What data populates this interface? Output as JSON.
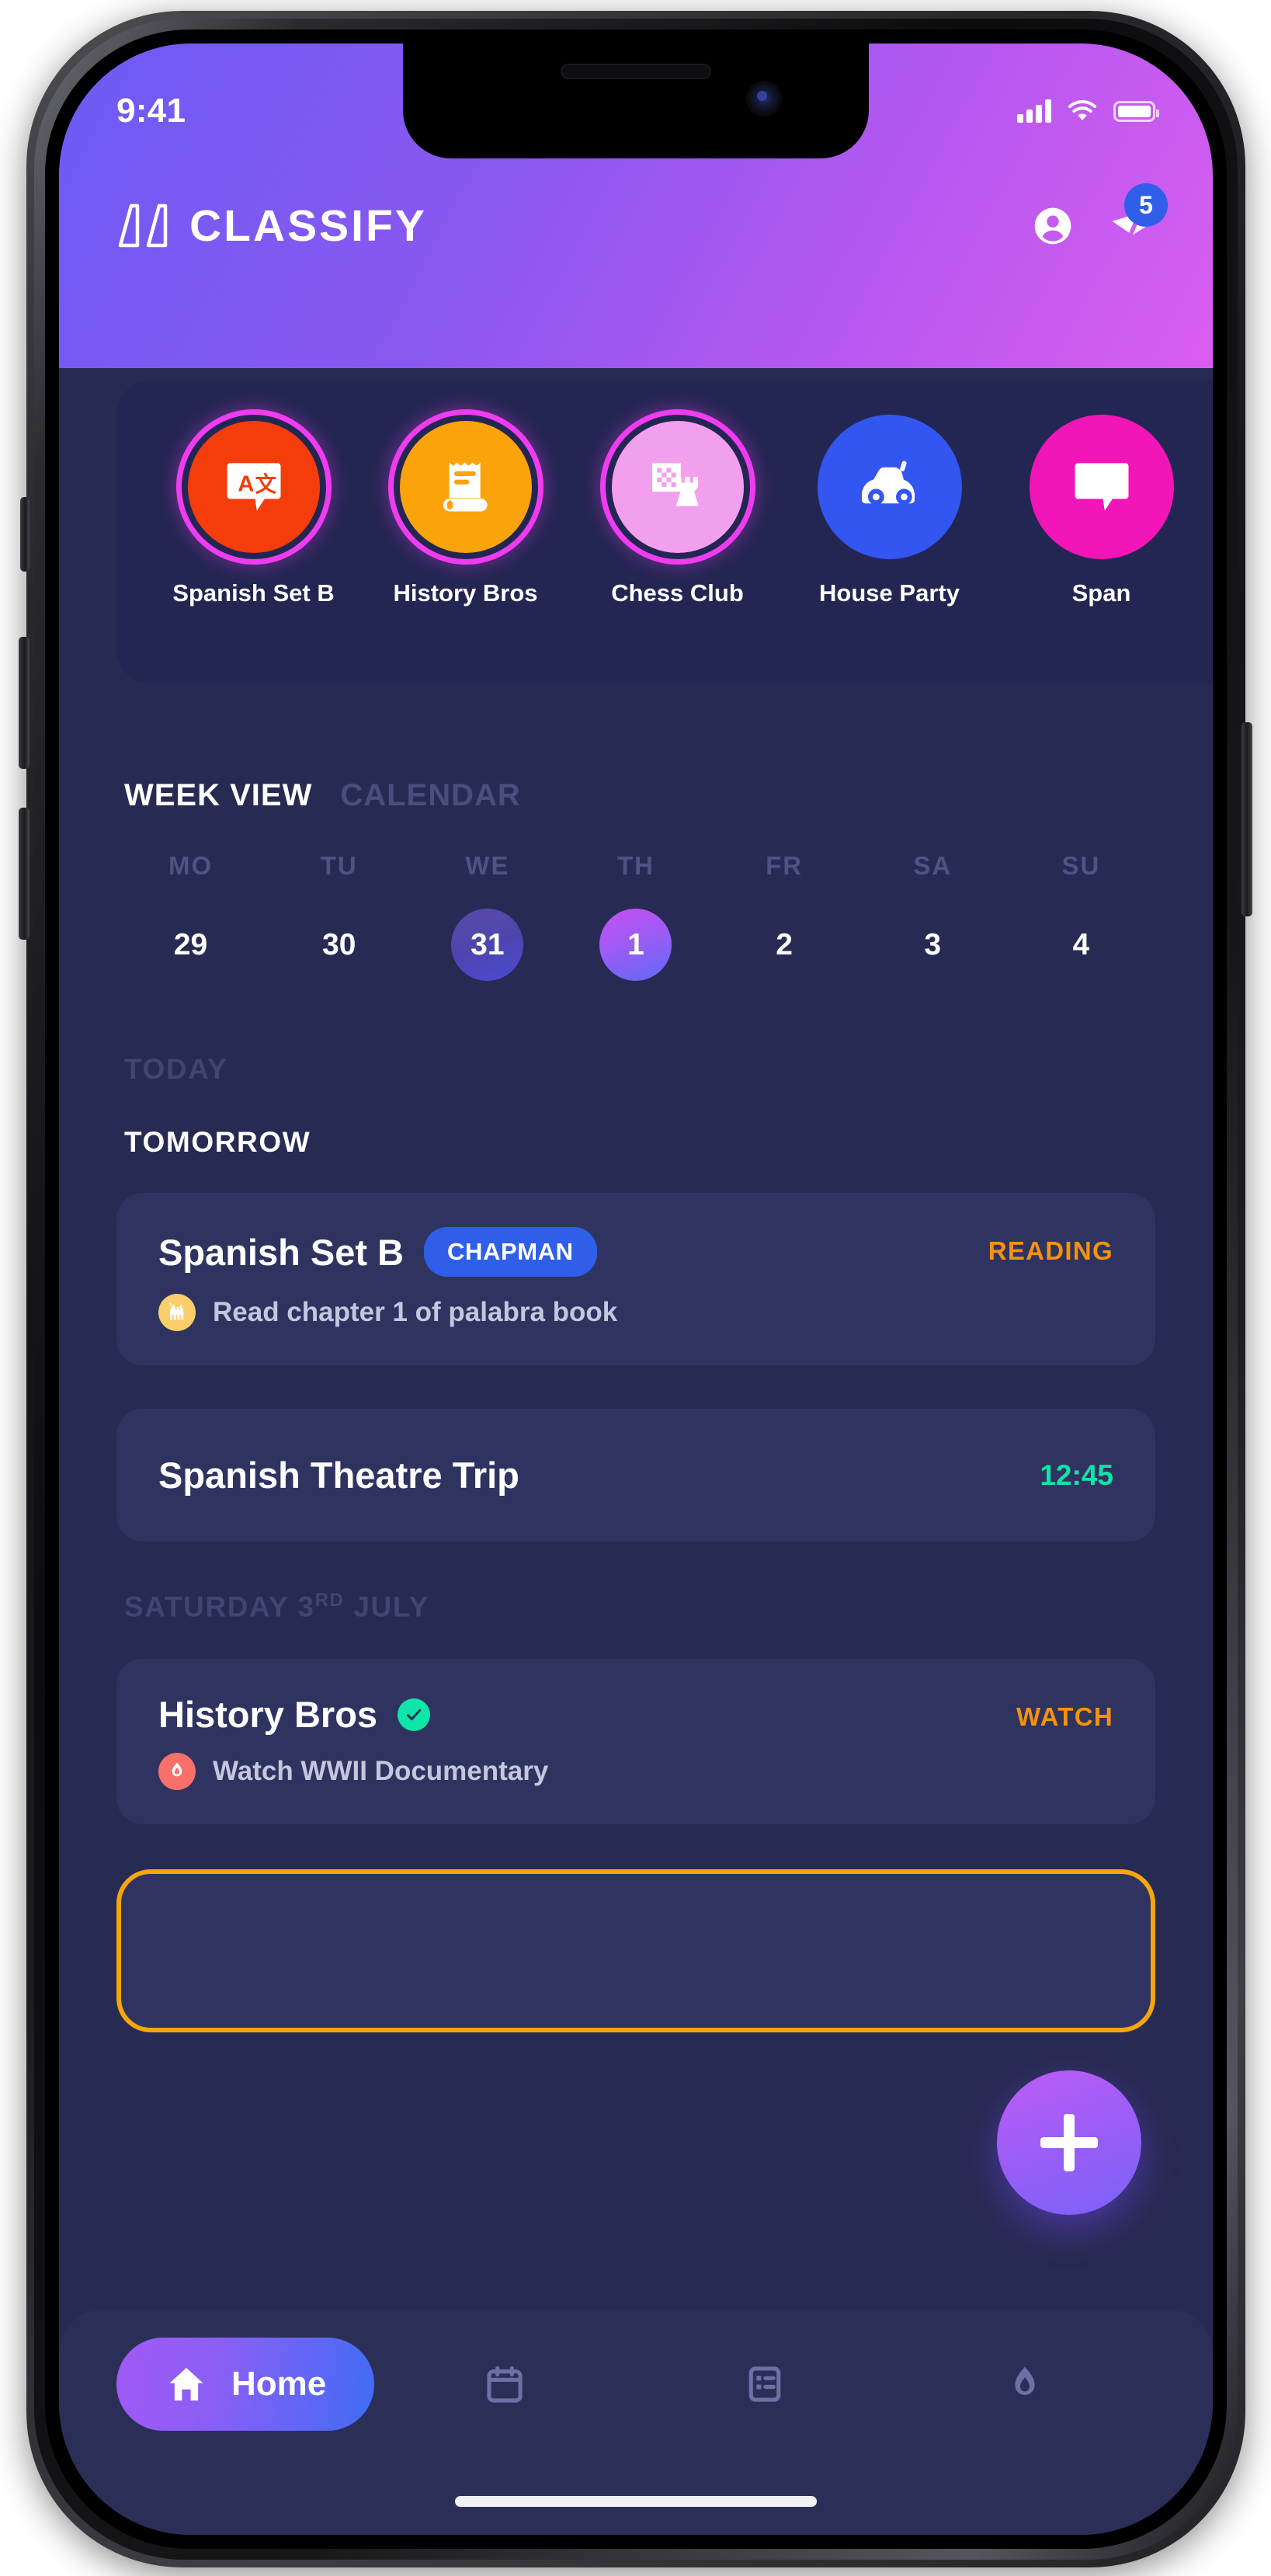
{
  "status_bar": {
    "time": "9:41",
    "icons": [
      "signal-bars-icon",
      "wifi-icon",
      "battery-icon"
    ]
  },
  "header": {
    "brand": "CLASSIFY",
    "logo_icon": "classify-logo-icon",
    "profile_icon": "account-circle-icon",
    "send_icon": "send-paper-plane-icon",
    "notification_count": "5"
  },
  "class_strip": {
    "items": [
      {
        "label": "Spanish Set B",
        "icon": "translate-icon",
        "bg": "#F53D0B",
        "ring": true
      },
      {
        "label": "History Bros",
        "icon": "scroll-document-icon",
        "bg": "#FBA30B",
        "ring": true
      },
      {
        "label": "Chess Club",
        "icon": "chess-rook-icon",
        "bg": "#F2A0EE",
        "ring": true
      },
      {
        "label": "House Party",
        "icon": "car-icon",
        "bg": "#3355F0",
        "ring": false
      },
      {
        "label": "Span",
        "icon": "translate-icon",
        "bg": "#F215B8",
        "ring": false
      }
    ]
  },
  "view_tabs": {
    "active": "WEEK VIEW",
    "inactive": "CALENDAR"
  },
  "week": {
    "days": [
      {
        "dow": "MO",
        "num": "29",
        "state": "normal"
      },
      {
        "dow": "TU",
        "num": "30",
        "state": "normal"
      },
      {
        "dow": "WE",
        "num": "31",
        "state": "today"
      },
      {
        "dow": "TH",
        "num": "1",
        "state": "selected"
      },
      {
        "dow": "FR",
        "num": "2",
        "state": "normal"
      },
      {
        "dow": "SA",
        "num": "3",
        "state": "normal"
      },
      {
        "dow": "SU",
        "num": "4",
        "state": "normal"
      }
    ]
  },
  "agenda": {
    "section_today": "TODAY",
    "section_tomorrow": "TOMORROW",
    "section_saturday_main": "SATURDAY 3",
    "section_saturday_sup": "RD",
    "section_saturday_tail": " JULY",
    "card1": {
      "title": "Spanish Set B",
      "pill": "CHAPMAN",
      "sub_icon": "cat-icon",
      "sub_text": "Read chapter 1 of palabra book",
      "tag": "READING",
      "tag_color": "#F5930A",
      "sub_icon_bg": "#FBCE6B"
    },
    "card2": {
      "title": "Spanish Theatre Trip",
      "time": "12:45",
      "time_color": "#0EE6A8"
    },
    "card3": {
      "title": "History Bros",
      "verified_icon": "check-circle-icon",
      "sub_icon": "flame-icon",
      "sub_text": "Watch WWII Documentary",
      "tag": "WATCH",
      "tag_color": "#F5930A",
      "sub_icon_bg": "#F9706B"
    }
  },
  "fab": {
    "icon": "plus-icon"
  },
  "bottom_nav": {
    "home_label": "Home",
    "items": [
      {
        "name": "home-icon",
        "active": true
      },
      {
        "name": "calendar-icon",
        "active": false
      },
      {
        "name": "list-icon",
        "active": false
      },
      {
        "name": "flame-icon",
        "active": false
      }
    ]
  },
  "colors": {
    "accent_purple": "#8A5FF6",
    "accent_blue": "#2F5FE8",
    "accent_orange": "#F5930A",
    "accent_green": "#0EE6A8",
    "card_bg": "#2F3360",
    "page_bg": "#272A52",
    "outline_yellow": "#F5A60B"
  }
}
